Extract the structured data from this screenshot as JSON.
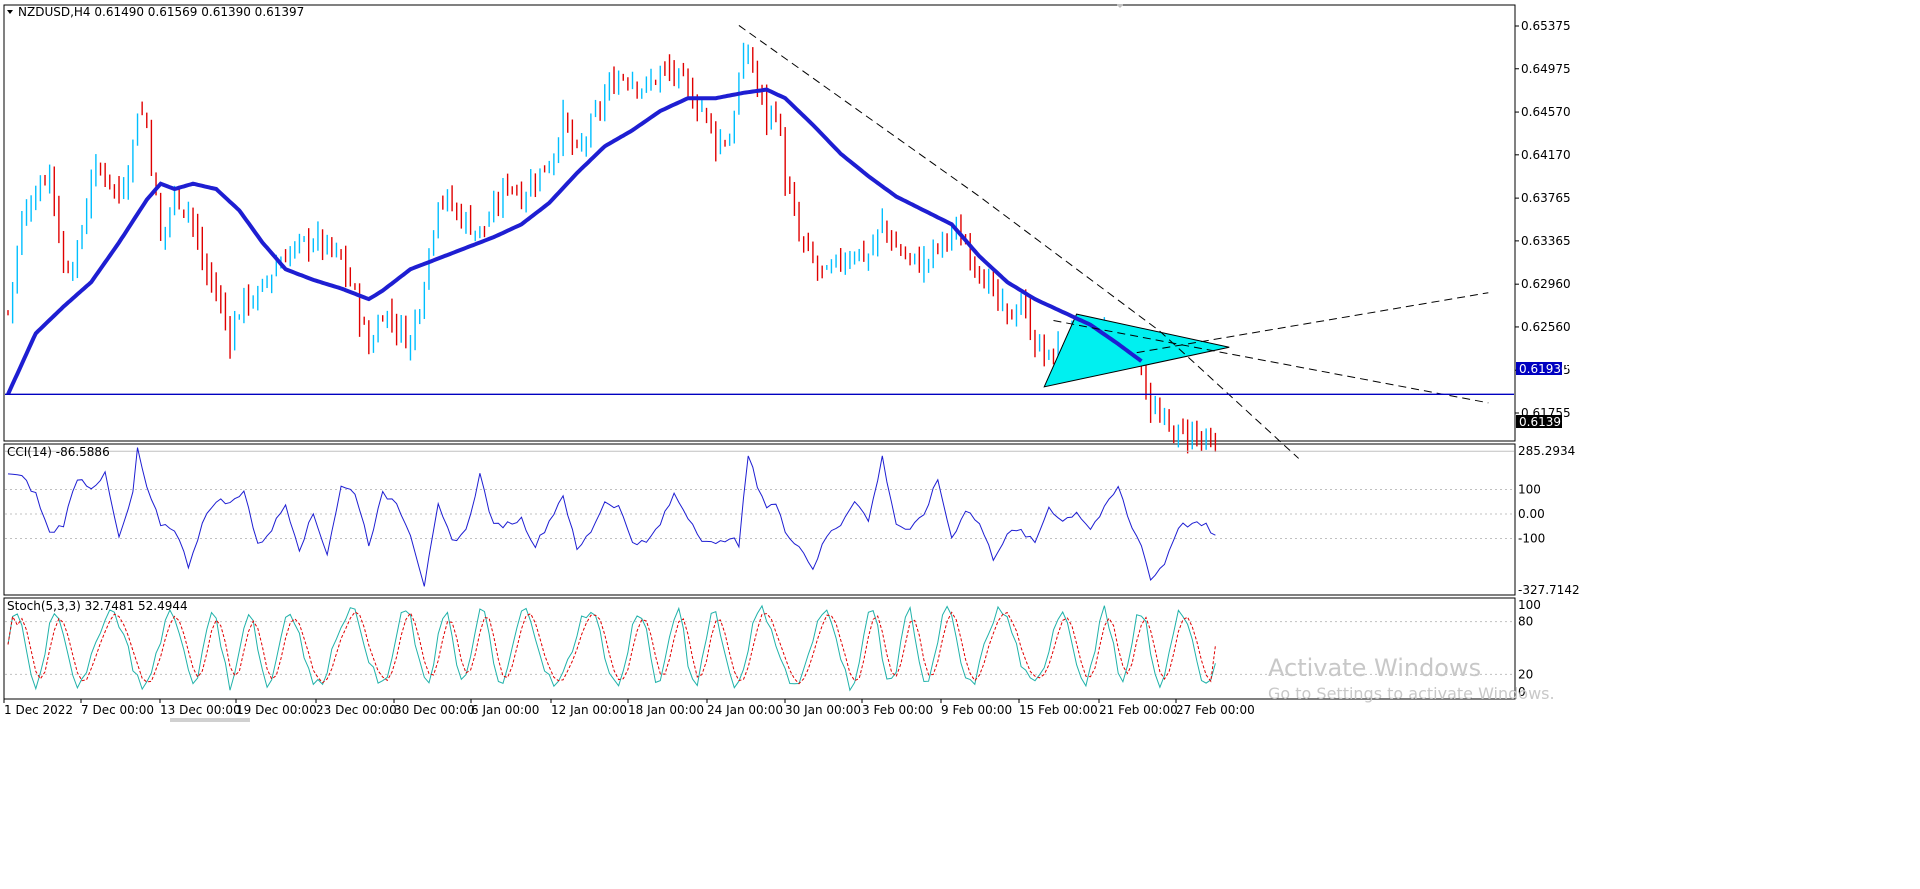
{
  "main_panel": {
    "header": "NZDUSD,H4  0.61490 0.61569 0.61390 0.61397",
    "menu_arrow_icon": "triangle-down"
  },
  "cci_panel": {
    "header": "CCI(14) -86.5886"
  },
  "stoch_panel": {
    "header": "Stoch(5,3,3) 32.7481 52.4944"
  },
  "watermark": {
    "line1": "Activate Windows",
    "line2": "Go to Settings to activate Windows."
  },
  "colors": {
    "bull": "#00bfff",
    "bear": "#e00000",
    "ma": "#1e1ed2",
    "cci": "#1e1ed2",
    "stoch_main": "#20b2aa",
    "stoch_signal": "#e00000",
    "pattern_fill": "#00f0f0",
    "hline": "#0000c0"
  },
  "chart_data": [
    {
      "type": "candlestick",
      "symbol": "NZDUSD",
      "timeframe": "H4",
      "ohlc_last": {
        "open": 0.6149,
        "high": 0.61569,
        "low": 0.6139,
        "close": 0.61397
      },
      "x_tick_labels": [
        "1 Dec 2022",
        "7 Dec 00:00",
        "13 Dec 00:00",
        "19 Dec 00:00",
        "23 Dec 00:00",
        "30 Dec 00:00",
        "6 Jan 00:00",
        "12 Jan 00:00",
        "18 Jan 00:00",
        "24 Jan 00:00",
        "30 Jan 00:00",
        "3 Feb 00:00",
        "9 Feb 00:00",
        "15 Feb 00:00",
        "21 Feb 00:00",
        "27 Feb 00:00"
      ],
      "y_tick_labels": [
        "0.65375",
        "0.64975",
        "0.64570",
        "0.64170",
        "0.63765",
        "0.63365",
        "0.62960",
        "0.62560",
        "0.62155",
        "0.61755"
      ],
      "ylim": [
        0.6128,
        0.6543
      ],
      "horizontal_line": {
        "value": 0.6193,
        "label": "0.61930"
      },
      "current_price": {
        "value": 0.61397,
        "label": "0.61397"
      },
      "close_anchors": [
        [
          0,
          0.627
        ],
        [
          3,
          0.6355
        ],
        [
          6,
          0.6385
        ],
        [
          9,
          0.6405
        ],
        [
          12,
          0.6312
        ],
        [
          15,
          0.6322
        ],
        [
          18,
          0.6398
        ],
        [
          21,
          0.6402
        ],
        [
          24,
          0.6378
        ],
        [
          27,
          0.6425
        ],
        [
          28,
          0.6462
        ],
        [
          30,
          0.6448
        ],
        [
          33,
          0.6335
        ],
        [
          36,
          0.638
        ],
        [
          39,
          0.6368
        ],
        [
          42,
          0.6315
        ],
        [
          45,
          0.6288
        ],
        [
          48,
          0.6248
        ],
        [
          51,
          0.6282
        ],
        [
          54,
          0.6283
        ],
        [
          57,
          0.6308
        ],
        [
          60,
          0.6325
        ],
        [
          63,
          0.633
        ],
        [
          66,
          0.634
        ],
        [
          69,
          0.6328
        ],
        [
          72,
          0.6318
        ],
        [
          75,
          0.6285
        ],
        [
          78,
          0.6235
        ],
        [
          81,
          0.6272
        ],
        [
          84,
          0.6258
        ],
        [
          87,
          0.6242
        ],
        [
          90,
          0.6302
        ],
        [
          93,
          0.638
        ],
        [
          96,
          0.6368
        ],
        [
          99,
          0.6355
        ],
        [
          102,
          0.6345
        ],
        [
          105,
          0.6362
        ],
        [
          108,
          0.6393
        ],
        [
          111,
          0.638
        ],
        [
          114,
          0.6396
        ],
        [
          117,
          0.641
        ],
        [
          120,
          0.6448
        ],
        [
          123,
          0.6415
        ],
        [
          126,
          0.6442
        ],
        [
          129,
          0.6472
        ],
        [
          132,
          0.6492
        ],
        [
          135,
          0.649
        ],
        [
          138,
          0.6478
        ],
        [
          141,
          0.6495
        ],
        [
          144,
          0.6492
        ],
        [
          147,
          0.6475
        ],
        [
          150,
          0.6462
        ],
        [
          153,
          0.643
        ],
        [
          156,
          0.6432
        ],
        [
          158,
          0.6488
        ],
        [
          160,
          0.6515
        ],
        [
          162,
          0.648
        ],
        [
          164,
          0.6452
        ],
        [
          166,
          0.6462
        ],
        [
          168,
          0.6395
        ],
        [
          171,
          0.6338
        ],
        [
          174,
          0.6315
        ],
        [
          177,
          0.6302
        ],
        [
          180,
          0.6318
        ],
        [
          183,
          0.6328
        ],
        [
          186,
          0.6322
        ],
        [
          189,
          0.6352
        ],
        [
          192,
          0.633
        ],
        [
          195,
          0.6318
        ],
        [
          198,
          0.6315
        ],
        [
          201,
          0.633
        ],
        [
          204,
          0.6345
        ],
        [
          207,
          0.6335
        ],
        [
          210,
          0.6312
        ],
        [
          213,
          0.6285
        ],
        [
          216,
          0.6262
        ],
        [
          219,
          0.6282
        ],
        [
          222,
          0.6242
        ],
        [
          225,
          0.6225
        ],
        [
          228,
          0.6238
        ],
        [
          231,
          0.625
        ],
        [
          234,
          0.6238
        ],
        [
          237,
          0.6245
        ],
        [
          240,
          0.6228
        ],
        [
          243,
          0.6235
        ],
        [
          245,
          0.622
        ],
        [
          247,
          0.6182
        ],
        [
          250,
          0.6162
        ],
        [
          253,
          0.6155
        ],
        [
          256,
          0.6158
        ],
        [
          259,
          0.6145
        ],
        [
          261,
          0.6139
        ]
      ],
      "moving_average_anchors": [
        [
          0,
          0.6193
        ],
        [
          6,
          0.625
        ],
        [
          12,
          0.6275
        ],
        [
          18,
          0.6298
        ],
        [
          24,
          0.6335
        ],
        [
          30,
          0.6375
        ],
        [
          33,
          0.639
        ],
        [
          36,
          0.6385
        ],
        [
          40,
          0.639
        ],
        [
          45,
          0.6385
        ],
        [
          50,
          0.6365
        ],
        [
          55,
          0.6335
        ],
        [
          60,
          0.631
        ],
        [
          66,
          0.63
        ],
        [
          72,
          0.6292
        ],
        [
          78,
          0.6282
        ],
        [
          81,
          0.629
        ],
        [
          87,
          0.631
        ],
        [
          93,
          0.632
        ],
        [
          99,
          0.633
        ],
        [
          105,
          0.634
        ],
        [
          111,
          0.6352
        ],
        [
          117,
          0.6372
        ],
        [
          123,
          0.64
        ],
        [
          129,
          0.6425
        ],
        [
          135,
          0.644
        ],
        [
          141,
          0.6458
        ],
        [
          147,
          0.647
        ],
        [
          153,
          0.647
        ],
        [
          159,
          0.6475
        ],
        [
          164,
          0.6478
        ],
        [
          168,
          0.647
        ],
        [
          174,
          0.6445
        ],
        [
          180,
          0.6418
        ],
        [
          186,
          0.6397
        ],
        [
          192,
          0.6378
        ],
        [
          198,
          0.6365
        ],
        [
          204,
          0.6352
        ],
        [
          210,
          0.6322
        ],
        [
          216,
          0.6298
        ],
        [
          222,
          0.6282
        ],
        [
          228,
          0.627
        ],
        [
          234,
          0.6258
        ],
        [
          240,
          0.624
        ],
        [
          245,
          0.6224
        ]
      ],
      "trendlines": [
        {
          "style": "dashed",
          "points": [
            [
              158,
              0.6538
            ],
            [
              210,
              0.6378
            ],
            [
              249,
              0.6252
            ],
            [
              279,
              0.6133
            ]
          ]
        },
        {
          "style": "dashed",
          "points": [
            [
              244,
              0.6232
            ],
            [
              320,
              0.6288
            ]
          ]
        },
        {
          "style": "dashed",
          "points": [
            [
              226,
              0.6262
            ],
            [
              320,
              0.6185
            ]
          ]
        }
      ],
      "triangle_pattern": {
        "points": [
          [
            224,
            0.62
          ],
          [
            231,
            0.6268
          ],
          [
            264,
            0.6237
          ]
        ]
      },
      "indicator": "MA"
    },
    {
      "type": "line",
      "name": "CCI(14)",
      "last_value": -86.5886,
      "y_tick_labels": [
        "285.2934",
        "100",
        "0.00",
        "-100",
        "-327.7142"
      ],
      "ylim": [
        -327.7142,
        285.2934
      ],
      "reference_levels": [
        100,
        0,
        -100
      ],
      "anchors": [
        [
          0,
          170
        ],
        [
          3,
          150
        ],
        [
          6,
          80
        ],
        [
          9,
          -80
        ],
        [
          12,
          -40
        ],
        [
          15,
          150
        ],
        [
          18,
          110
        ],
        [
          21,
          160
        ],
        [
          24,
          -100
        ],
        [
          27,
          80
        ],
        [
          28,
          270
        ],
        [
          30,
          100
        ],
        [
          33,
          -40
        ],
        [
          36,
          -60
        ],
        [
          39,
          -210
        ],
        [
          42,
          -40
        ],
        [
          45,
          60
        ],
        [
          48,
          40
        ],
        [
          51,
          100
        ],
        [
          54,
          -130
        ],
        [
          57,
          -60
        ],
        [
          60,
          40
        ],
        [
          63,
          -140
        ],
        [
          66,
          0
        ],
        [
          69,
          -160
        ],
        [
          72,
          110
        ],
        [
          75,
          90
        ],
        [
          78,
          -120
        ],
        [
          81,
          80
        ],
        [
          84,
          50
        ],
        [
          87,
          -80
        ],
        [
          90,
          -290
        ],
        [
          93,
          30
        ],
        [
          96,
          -110
        ],
        [
          99,
          -70
        ],
        [
          102,
          160
        ],
        [
          105,
          -50
        ],
        [
          108,
          -40
        ],
        [
          111,
          -20
        ],
        [
          114,
          -130
        ],
        [
          117,
          -30
        ],
        [
          120,
          80
        ],
        [
          123,
          -150
        ],
        [
          126,
          -70
        ],
        [
          129,
          50
        ],
        [
          132,
          30
        ],
        [
          135,
          -110
        ],
        [
          138,
          -120
        ],
        [
          141,
          -40
        ],
        [
          144,
          80
        ],
        [
          147,
          -10
        ],
        [
          150,
          -100
        ],
        [
          153,
          -130
        ],
        [
          156,
          -90
        ],
        [
          158,
          -130
        ],
        [
          160,
          240
        ],
        [
          162,
          120
        ],
        [
          164,
          30
        ],
        [
          166,
          40
        ],
        [
          168,
          -70
        ],
        [
          171,
          -130
        ],
        [
          174,
          -220
        ],
        [
          177,
          -90
        ],
        [
          180,
          -40
        ],
        [
          183,
          60
        ],
        [
          186,
          -30
        ],
        [
          189,
          230
        ],
        [
          192,
          -40
        ],
        [
          195,
          -70
        ],
        [
          198,
          0
        ],
        [
          201,
          140
        ],
        [
          204,
          -100
        ],
        [
          207,
          20
        ],
        [
          210,
          -40
        ],
        [
          213,
          -180
        ],
        [
          216,
          -80
        ],
        [
          219,
          -70
        ],
        [
          222,
          -120
        ],
        [
          225,
          30
        ],
        [
          228,
          -30
        ],
        [
          231,
          10
        ],
        [
          234,
          -60
        ],
        [
          237,
          20
        ],
        [
          240,
          110
        ],
        [
          243,
          -60
        ],
        [
          245,
          -120
        ],
        [
          247,
          -270
        ],
        [
          250,
          -200
        ],
        [
          253,
          -50
        ],
        [
          256,
          -40
        ],
        [
          259,
          -50
        ],
        [
          261,
          -87
        ]
      ]
    },
    {
      "type": "line",
      "name": "Stoch(5,3,3)",
      "main_last": 32.7481,
      "signal_last": 52.4944,
      "y_tick_labels": [
        "100",
        "80",
        "20",
        "0"
      ],
      "ylim": [
        0,
        100
      ],
      "reference_levels": [
        80,
        20
      ]
    }
  ]
}
